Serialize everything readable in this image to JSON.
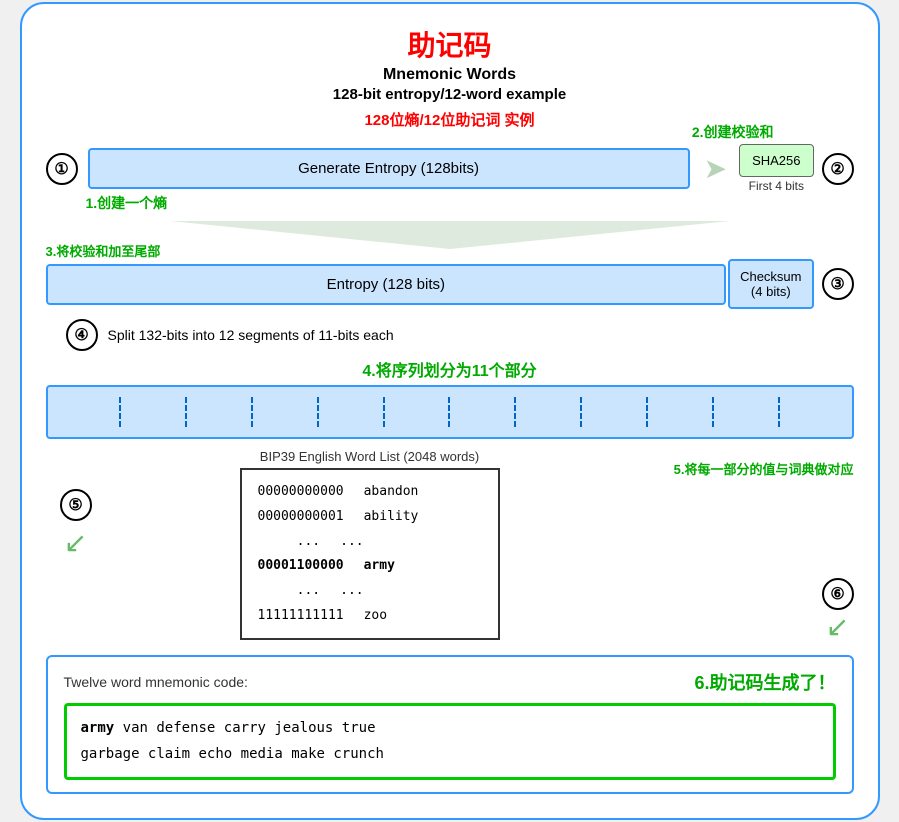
{
  "title": {
    "zh": "助记码",
    "en1": "Mnemonic Words",
    "en2": "128-bit entropy/12-word example",
    "zh2": "128位熵/12位助记词 实例"
  },
  "annotations": {
    "a1": "1.创建一个熵",
    "a2": "2.创建校验和",
    "a3": "3.将校验和加至尾部",
    "a4": "4.将序列划分为11个部分",
    "a5": "5.将每一部分的值与词典做对应",
    "a6": "6.助记码生成了！"
  },
  "steps": {
    "s1_label": "Generate Entropy (128bits)",
    "s2_label": "SHA256",
    "s2_sub": "First 4 bits",
    "s3_entropy": "Entropy (128 bits)",
    "s3_checksum": "Checksum\n(4 bits)",
    "s4_label": "Split 132-bits into 12 segments of 11-bits each",
    "s5_title": "BIP39 English Word List (2048 words)",
    "s6_label": "Twelve word mnemonic code:"
  },
  "wordlist": {
    "rows": [
      {
        "bin": "00000000000",
        "word": "abandon"
      },
      {
        "bin": "00000000001",
        "word": "ability"
      },
      {
        "bin": "...",
        "word": "..."
      },
      {
        "bin": "00001100000",
        "word": "army",
        "highlight": true
      },
      {
        "bin": "...",
        "word": "..."
      },
      {
        "bin": "11111111111",
        "word": "zoo"
      }
    ]
  },
  "mnemonic": {
    "line1": "army van defense carry jealous true",
    "line2": "garbage claim echo media make crunch",
    "first_word": "army"
  },
  "circles": {
    "c1": "①",
    "c2": "②",
    "c3": "③",
    "c4": "④",
    "c5": "⑤",
    "c6": "⑥"
  }
}
